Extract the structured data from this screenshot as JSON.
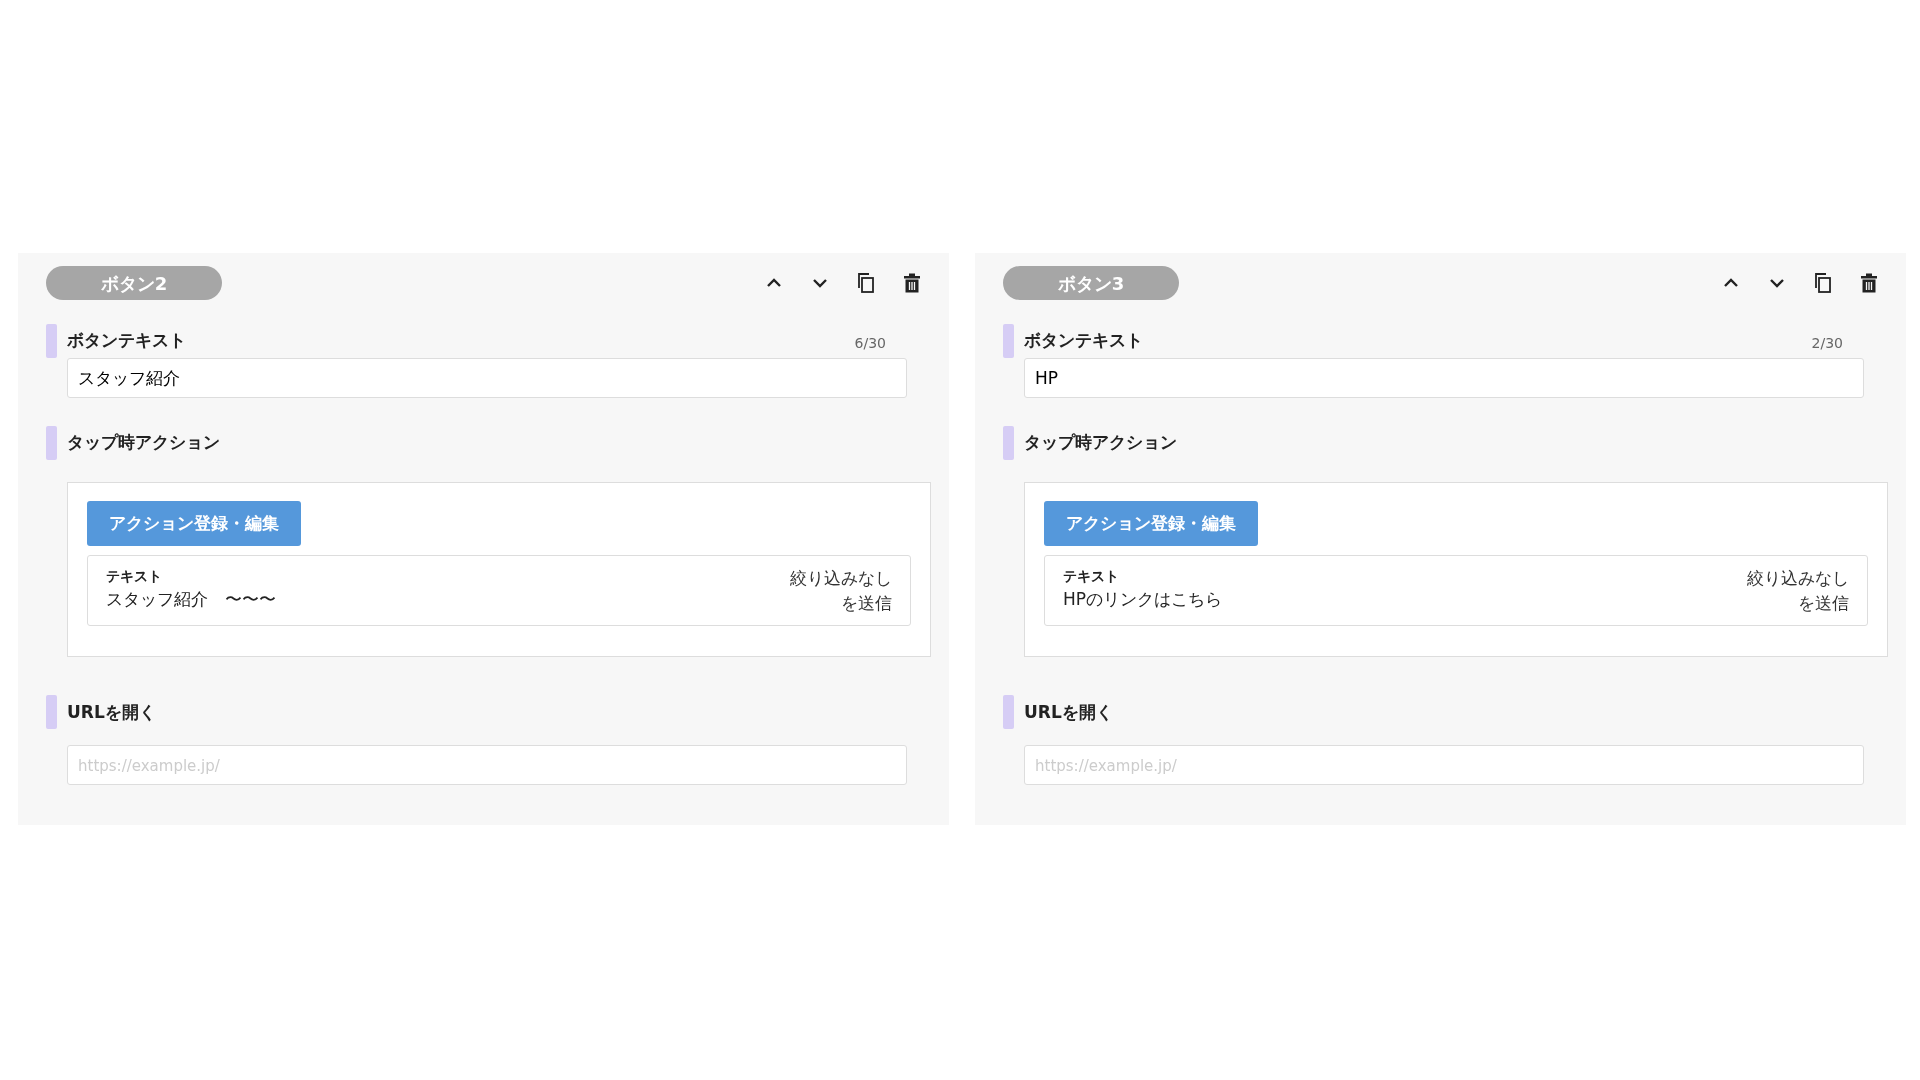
{
  "panels": [
    {
      "title": "ボタン2",
      "button_text": {
        "label": "ボタンテキスト",
        "counter": "6/30",
        "value": "スタッフ紹介"
      },
      "tap_action": {
        "label": "タップ時アクション",
        "button": "アクション登録・編集",
        "action": {
          "type": "テキスト",
          "text": "スタッフ紹介　〜〜〜",
          "summary_lines": [
            "絞り込みなし",
            "を送信"
          ]
        }
      },
      "url": {
        "label": "URLを開く",
        "placeholder": "https://example.jp/"
      }
    },
    {
      "title": "ボタン3",
      "button_text": {
        "label": "ボタンテキスト",
        "counter": "2/30",
        "value": "HP"
      },
      "tap_action": {
        "label": "タップ時アクション",
        "button": "アクション登録・編集",
        "action": {
          "type": "テキスト",
          "text": "HPのリンクはこちら",
          "summary_lines": [
            "絞り込みなし",
            "を送信"
          ]
        }
      },
      "url": {
        "label": "URLを開く",
        "placeholder": "https://example.jp/"
      }
    }
  ]
}
